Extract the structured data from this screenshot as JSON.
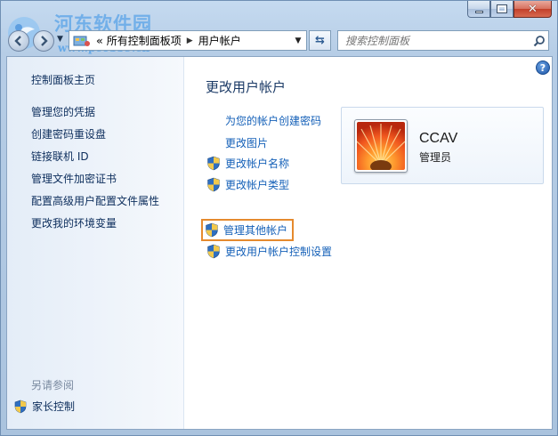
{
  "watermark": {
    "text": "河东软件园",
    "url": "www.pc0359.cn"
  },
  "window_controls": {
    "minimize": "minimize",
    "maximize": "maximize",
    "close": "close"
  },
  "address": {
    "chevron": "«",
    "crumbs": [
      "所有控制面板项",
      "用户帐户"
    ]
  },
  "search": {
    "placeholder": "搜索控制面板"
  },
  "sidebar": {
    "home": "控制面板主页",
    "links": [
      "管理您的凭据",
      "创建密码重设盘",
      "链接联机 ID",
      "管理文件加密证书",
      "配置高级用户配置文件属性",
      "更改我的环境变量"
    ],
    "see_also": "另请参阅",
    "parental": "家长控制"
  },
  "main": {
    "help": "?",
    "title": "更改用户帐户",
    "tasks": [
      {
        "label": "为您的帐户创建密码",
        "shield": false
      },
      {
        "label": "更改图片",
        "shield": false
      },
      {
        "label": "更改帐户名称",
        "shield": true
      },
      {
        "label": "更改帐户类型",
        "shield": true
      }
    ],
    "tasks2": [
      {
        "label": "管理其他帐户",
        "shield": true,
        "highlight": true
      },
      {
        "label": "更改用户帐户控制设置",
        "shield": true
      }
    ]
  },
  "user": {
    "name": "CCAV",
    "role": "管理员"
  },
  "colors": {
    "link": "#1460b8",
    "highlight_border": "#e58a2e",
    "sidebar_link": "#0c2d5c"
  }
}
